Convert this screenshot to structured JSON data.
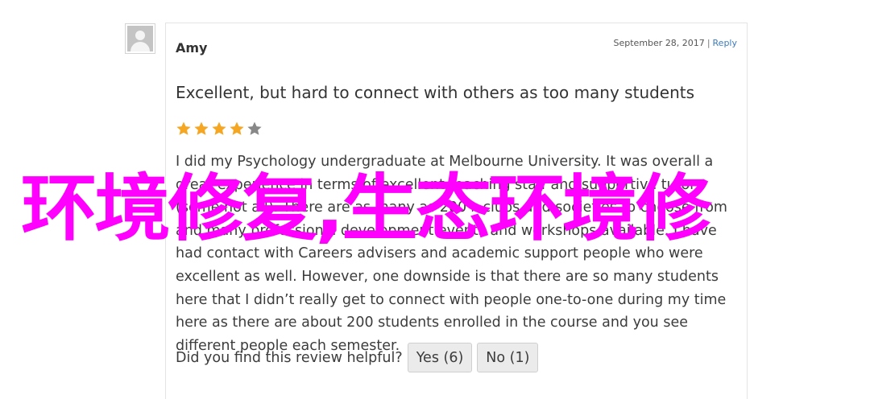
{
  "review": {
    "author": "Amy",
    "date": "September 28, 2017",
    "separator": "|",
    "reply_label": "Reply",
    "title": "Excellent, but hard to connect with others as too many students",
    "rating": 4,
    "rating_max": 5,
    "star_color_filled": "#f5a623",
    "star_color_empty": "#888888",
    "body": "I did my Psychology undergraduate at Melbourne University. It was overall a great experience in terms of excellent teaching staff and supportive tutors (some not all). There are as many as 200+ clubs and societies to choose from and many professional development events and workshops available. I have had contact with Careers advisers and academic support people who were excellent as well. However, one downside is that there are so many students here that I didn’t really get to connect with people one-to-one during my time here as there are about 200 students enrolled in the course and you see different people each semester.",
    "helpful_question": "Did you find this review helpful?",
    "yes_label": "Yes (6)",
    "no_label": "No (1)"
  },
  "overlay": {
    "text": "环境修复,生态环境修",
    "color": "#ff00ff"
  },
  "icons": {
    "avatar": "default-user-avatar-icon",
    "star": "star-icon"
  }
}
